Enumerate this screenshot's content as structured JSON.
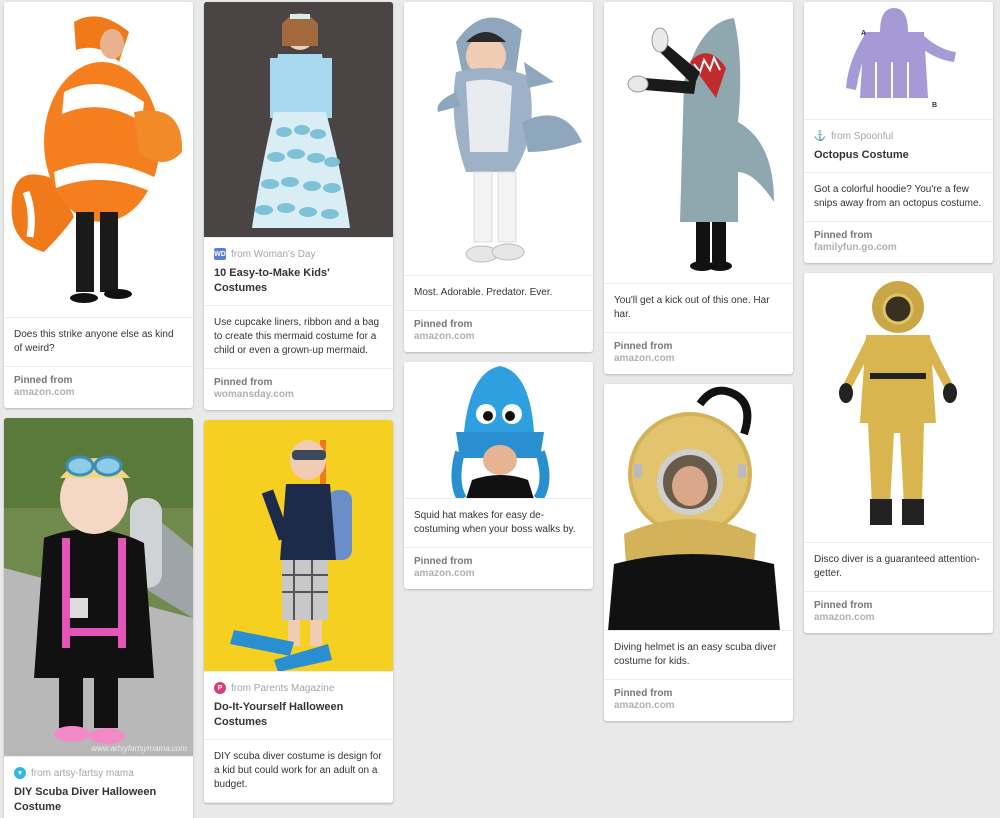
{
  "pins": {
    "nemo": {
      "description": "Does this strike anyone else as kind of weird?",
      "pinned_label": "Pinned from",
      "pinned_domain": "amazon.com"
    },
    "scuba_kid": {
      "source": "from artsy-fartsy mama",
      "title": "DIY Scuba Diver Halloween Costume",
      "watermark": "www.artsyfartsymama.com"
    },
    "mermaid": {
      "source": "from Woman's Day",
      "source_icon": "WD",
      "title": "10 Easy-to-Make Kids' Costumes",
      "description": "Use cupcake liners, ribbon and a bag to create this mermaid costume for a child or even a grown-up mermaid.",
      "pinned_label": "Pinned from",
      "pinned_domain": "womansday.com"
    },
    "parents_diver": {
      "source": "from Parents Magazine",
      "source_icon": "P",
      "title": "Do-It-Yourself Halloween Costumes",
      "description": "DIY scuba diver costume is design for a kid but could work for an adult on a budget."
    },
    "shark_kid": {
      "description": "Most. Adorable. Predator. Ever.",
      "pinned_label": "Pinned from",
      "pinned_domain": "amazon.com"
    },
    "squid": {
      "description": "Squid hat makes for easy de-costuming when your boss walks by.",
      "pinned_label": "Pinned from",
      "pinned_domain": "amazon.com"
    },
    "shark_adult": {
      "description": "You'll get a kick out of this one. Har har.",
      "pinned_label": "Pinned from",
      "pinned_domain": "amazon.com"
    },
    "helmet": {
      "description": "Diving helmet is an easy scuba diver costume for kids.",
      "pinned_label": "Pinned from",
      "pinned_domain": "amazon.com"
    },
    "octopus": {
      "source": "from Spoonful",
      "title": "Octopus Costume",
      "description": "Got a colorful hoodie? You're a few snips away from an octopus costume.",
      "pinned_label": "Pinned from",
      "pinned_domain": "familyfun.go.com",
      "diagram_label_a": "A",
      "diagram_label_b": "B"
    },
    "disco": {
      "description": "Disco diver is a guaranteed attention-getter.",
      "pinned_label": "Pinned from",
      "pinned_domain": "amazon.com"
    }
  },
  "colors": {
    "background": "#e9e9e9",
    "card": "#ffffff",
    "wd_icon": "#5b7fd6",
    "parents_icon": "#e03a7a",
    "artsy_icon": "#33b5e5"
  }
}
